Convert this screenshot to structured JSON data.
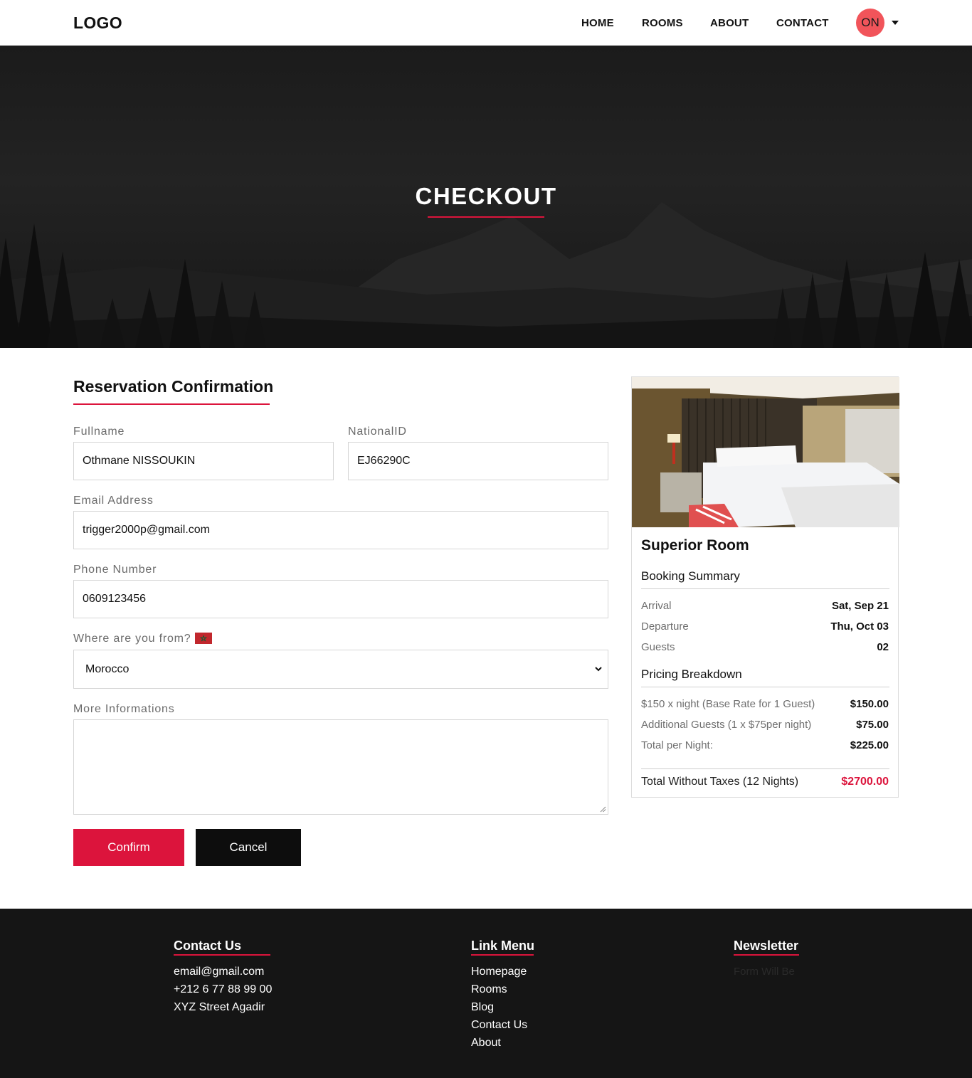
{
  "header": {
    "logo": "LOGO",
    "nav": [
      "HOME",
      "ROOMS",
      "ABOUT",
      "CONTACT"
    ],
    "avatar_initials": "ON"
  },
  "hero": {
    "title": "CHECKOUT"
  },
  "form": {
    "title": "Reservation Confirmation",
    "fullname_label": "Fullname",
    "fullname_value": "Othmane NISSOUKIN",
    "nationalid_label": "NationalID",
    "nationalid_value": "EJ66290C",
    "email_label": "Email Address",
    "email_value": "trigger2000p@gmail.com",
    "phone_label": "Phone Number",
    "phone_value": "0609123456",
    "country_label": "Where are you from?",
    "country_value": "Morocco",
    "more_label": "More Informations",
    "more_value": "",
    "confirm_label": "Confirm",
    "cancel_label": "Cancel"
  },
  "summary": {
    "room_name": "Superior Room",
    "booking_title": "Booking Summary",
    "arrival_label": "Arrival",
    "arrival_value": "Sat, Sep 21",
    "departure_label": "Departure",
    "departure_value": "Thu, Oct 03",
    "guests_label": "Guests",
    "guests_value": "02",
    "pricing_title": "Pricing Breakdown",
    "base_label": "$150 x night (Base Rate for 1 Guest)",
    "base_value": "$150.00",
    "additional_label": "Additional Guests (1 x $75per night)",
    "additional_value": "$75.00",
    "per_night_label": "Total per Night:",
    "per_night_value": "$225.00",
    "total_label": "Total Without Taxes (12 Nights)",
    "total_value": "$2700.00"
  },
  "footer": {
    "contact_title": "Contact Us",
    "contact_items": [
      "email@gmail.com",
      "+212 6 77 88 99 00",
      "XYZ Street Agadir"
    ],
    "links_title": "Link Menu",
    "links": [
      "Homepage",
      "Rooms",
      "Blog",
      "Contact Us",
      "About"
    ],
    "newsletter_title": "Newsletter",
    "newsletter_text": "Form Will Be"
  },
  "colors": {
    "accent": "#dc143c",
    "avatar": "#f1545a",
    "dark": "#151515"
  }
}
